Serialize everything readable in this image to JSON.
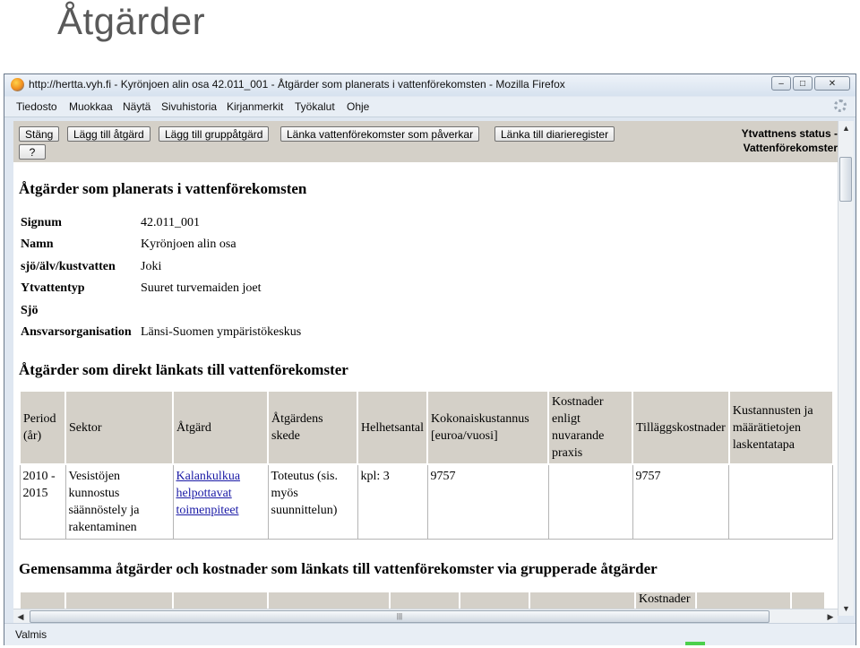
{
  "slide": {
    "title": "Åtgärder"
  },
  "window": {
    "title": "http://hertta.vyh.fi - Kyrönjoen alin osa 42.011_001 - Åtgärder som planerats i vattenförekomsten - Mozilla Firefox",
    "buttons": {
      "minimize": "–",
      "maximize": "□",
      "close": "✕"
    }
  },
  "menu": [
    {
      "label": "Tiedosto"
    },
    {
      "label": "Muokkaa"
    },
    {
      "label": "Näytä"
    },
    {
      "label": "Sivuhistoria"
    },
    {
      "label": "Kirjanmerkit"
    },
    {
      "label": "Työkalut"
    },
    {
      "label": "Ohje"
    }
  ],
  "toolbar": {
    "buttons": [
      "Stäng",
      "Lägg till åtgärd",
      "Lägg till gruppåtgärd",
      "Länka vattenförekomster som påverkar",
      "Länka till diarieregister",
      "?"
    ],
    "status_line1": "Ytvattnens status -",
    "status_line2": "Vattenförekomster"
  },
  "page": {
    "heading": "Åtgärder som planerats i vattenförekomsten",
    "info": [
      {
        "label": "Signum",
        "value": "42.011_001"
      },
      {
        "label": "Namn",
        "value": "Kyrönjoen alin osa"
      },
      {
        "label": "sjö/älv/kustvatten",
        "value": "Joki"
      },
      {
        "label": "Ytvattentyp",
        "value": "Suuret turvemaiden joet"
      },
      {
        "label": "Sjö",
        "value": ""
      },
      {
        "label": "Ansvarsorganisation",
        "value": "Länsi-Suomen ympäristökeskus"
      }
    ],
    "direct_heading": "Åtgärder som direkt länkats till vattenförekomster",
    "table_headers": [
      "Period (år)",
      "Sektor",
      "Åtgärd",
      "Åtgärdens skede",
      "Helhetsantal",
      "Kokonaiskustannus [euroa/vuosi]",
      "Kostnader enligt nuvarande praxis",
      "Tilläggskostnader",
      "Kustannusten ja määrätietojen laskentatapa"
    ],
    "table_row": {
      "period": "2010 - 2015",
      "sektor": "Vesistöjen kunnostus säännöstely ja rakentaminen",
      "atgard": "Kalankulkua helpottavat toimenpiteet",
      "skede": "Toteutus (sis. myös suunnittelun)",
      "helhetsantal": "kpl: 3",
      "kokonaiskustannus": "9757",
      "kostnader": "",
      "tillagg": "9757",
      "laskentatapa": ""
    },
    "group_heading": "Gemensamma åtgärder och kostnader som länkats till vattenförekomster via grupperade åtgärder",
    "group_partial_header": "Kostnader"
  },
  "statusbar": {
    "text": "Valmis"
  }
}
